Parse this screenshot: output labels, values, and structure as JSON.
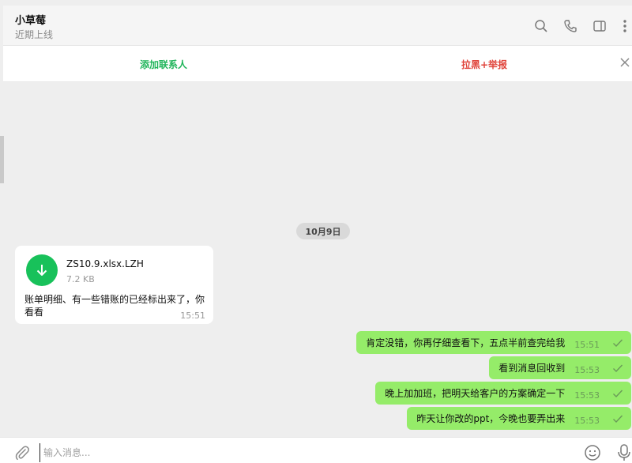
{
  "header": {
    "contact_name": "小草莓",
    "status": "近期上线",
    "icons": [
      "search-icon",
      "phone-icon",
      "sidebar-toggle-icon",
      "more-vertical-icon"
    ]
  },
  "banner": {
    "add_contact_label": "添加联系人",
    "block_report_label": "拉黑+举报",
    "close_icon": "close-icon"
  },
  "chat": {
    "date_label": "10月9日",
    "incoming": {
      "file_name": "ZS10.9.xlsx.LZH",
      "file_size": "7.2 KB",
      "text": "账单明细、有一些错账的已经标出来了，你看看",
      "time": "15:51",
      "file_icon": "download-icon",
      "file_icon_color": "#18c15a"
    },
    "outgoing": [
      {
        "text": "肯定没错，你再仔细查看下，五点半前查完给我",
        "time": "15:51"
      },
      {
        "text": "看到消息回收到",
        "time": "15:53"
      },
      {
        "text": "晚上加加班，把明天给客户的方案确定一下",
        "time": "15:53"
      },
      {
        "text": "昨天让你改的ppt，今晚也要弄出来",
        "time": "15:53"
      }
    ],
    "outgoing_bubble_color": "#95ec69"
  },
  "composer": {
    "placeholder": "输入消息...",
    "value": "",
    "icons": [
      "attachment-icon",
      "emoji-icon",
      "microphone-icon"
    ]
  },
  "colors": {
    "accent_green": "#21b55b",
    "danger_red": "#e0433a"
  }
}
